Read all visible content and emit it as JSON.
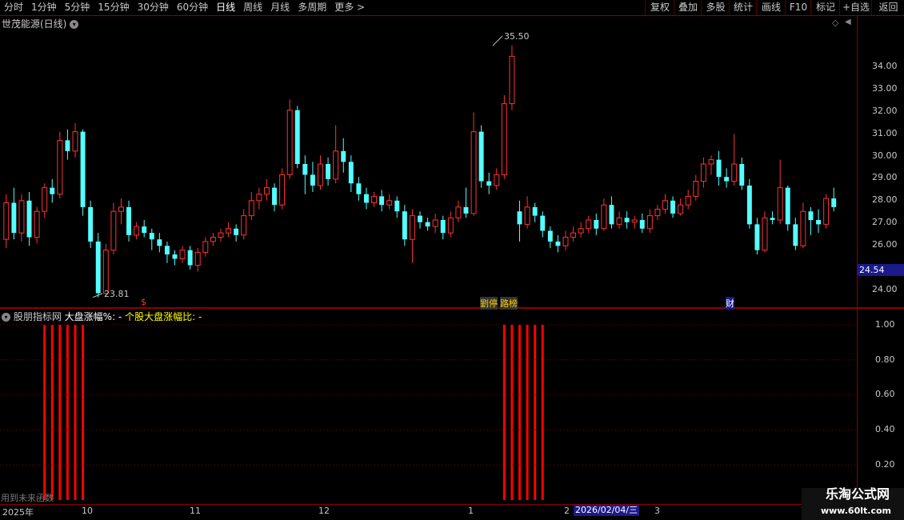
{
  "toolbar": {
    "periods": [
      "分时",
      "1分钟",
      "5分钟",
      "15分钟",
      "30分钟",
      "60分钟",
      "日线",
      "周线",
      "月线",
      "多周期",
      "更多 >"
    ],
    "active_period": "日线",
    "right_buttons": [
      "复权",
      "叠加",
      "多股",
      "统计",
      "画线",
      "F10",
      "标记",
      "+自选",
      "返回"
    ]
  },
  "main_chart": {
    "title": "世茂能源(日线)",
    "high_label": "35.50",
    "low_label": "23.81",
    "price_tag": "24.54",
    "y_ticks": [
      "34.00",
      "33.00",
      "32.00",
      "31.00",
      "30.00",
      "29.00",
      "28.00",
      "27.00",
      "26.00",
      "24.00"
    ],
    "markers": [
      {
        "text": "$",
        "color": "#ff3030"
      },
      {
        "text": "劉停",
        "color": "#ffcc00"
      },
      {
        "text": "路榜",
        "color": "#ffcc00"
      },
      {
        "text": "财",
        "color": "#ffffff"
      }
    ]
  },
  "indicator": {
    "name": "股朋指标网",
    "line1": "大盘涨幅%: -",
    "line2": "个股大盘涨幅比: -",
    "y_ticks": [
      "1.00",
      "0.80",
      "0.60",
      "0.40",
      "0.20"
    ],
    "footer_note": "用到未来函数"
  },
  "time_axis": {
    "labels": [
      "2025年",
      "10",
      "11",
      "12",
      "1",
      "2",
      "3"
    ],
    "date_tag": "2026/02/04/三"
  },
  "watermark": {
    "line1": "乐淘公式网",
    "line2": "www.60lt.com"
  },
  "colors": {
    "up": "#ff3232",
    "down": "#54ffff",
    "background": "#000000",
    "grid": "#8b0000",
    "bar": "#ff0000",
    "indicator_line1": "#ffffff",
    "indicator_line2": "#ffff00"
  },
  "chart_data": [
    {
      "type": "candlestick",
      "ylim": [
        23.5,
        36.5
      ],
      "high": 35.5,
      "low": 23.81,
      "candles": [
        [
          26.5,
          28.2,
          28.6,
          26.1
        ],
        [
          28.2,
          26.8,
          28.9,
          26.5
        ],
        [
          26.8,
          28.3,
          28.6,
          26.4
        ],
        [
          28.3,
          26.6,
          28.7,
          26.2
        ],
        [
          26.6,
          27.8,
          28.0,
          26.3
        ],
        [
          27.8,
          28.9,
          29.1,
          27.5
        ],
        [
          28.9,
          28.6,
          29.3,
          28.2
        ],
        [
          28.6,
          31.1,
          31.5,
          28.4
        ],
        [
          31.1,
          30.6,
          31.6,
          30.2
        ],
        [
          30.6,
          31.5,
          31.9,
          30.3
        ],
        [
          31.5,
          28.0,
          31.6,
          27.6
        ],
        [
          28.0,
          26.4,
          28.3,
          26.1
        ],
        [
          26.4,
          24.0,
          26.8,
          23.81
        ],
        [
          24.0,
          26.0,
          26.3,
          23.9
        ],
        [
          26.0,
          27.8,
          28.2,
          25.8
        ],
        [
          27.8,
          28.0,
          28.4,
          27.2
        ],
        [
          28.0,
          26.7,
          28.3,
          26.4
        ],
        [
          26.7,
          27.1,
          27.3,
          26.5
        ],
        [
          27.1,
          26.8,
          27.4,
          26.6
        ],
        [
          26.8,
          26.5,
          27.0,
          26.0
        ],
        [
          26.5,
          26.2,
          26.8,
          25.9
        ],
        [
          26.2,
          25.8,
          26.4,
          25.4
        ],
        [
          25.8,
          25.6,
          26.0,
          25.3
        ],
        [
          25.6,
          26.0,
          26.2,
          25.4
        ],
        [
          26.0,
          25.3,
          26.2,
          25.1
        ],
        [
          25.3,
          25.9,
          26.1,
          25.0
        ],
        [
          25.9,
          26.4,
          26.6,
          25.7
        ],
        [
          26.4,
          26.6,
          26.8,
          26.2
        ],
        [
          26.6,
          26.8,
          27.0,
          26.4
        ],
        [
          26.8,
          27.0,
          27.3,
          26.6
        ],
        [
          27.0,
          26.7,
          27.2,
          26.4
        ],
        [
          26.7,
          27.6,
          27.9,
          26.5
        ],
        [
          27.6,
          28.3,
          28.7,
          27.4
        ],
        [
          28.3,
          28.6,
          28.9,
          27.9
        ],
        [
          28.6,
          28.9,
          29.3,
          28.3
        ],
        [
          28.9,
          28.1,
          29.1,
          27.8
        ],
        [
          28.1,
          29.5,
          29.8,
          27.9
        ],
        [
          29.5,
          32.5,
          33.0,
          29.3
        ],
        [
          32.5,
          30.0,
          32.7,
          29.8
        ],
        [
          30.0,
          29.5,
          30.4,
          28.6
        ],
        [
          29.5,
          29.0,
          30.1,
          28.7
        ],
        [
          29.0,
          30.0,
          30.4,
          28.8
        ],
        [
          30.0,
          29.3,
          30.3,
          29.0
        ],
        [
          29.3,
          30.6,
          31.8,
          29.1
        ],
        [
          30.6,
          30.1,
          31.2,
          29.6
        ],
        [
          30.1,
          29.1,
          30.4,
          28.7
        ],
        [
          29.1,
          28.6,
          29.4,
          28.3
        ],
        [
          28.6,
          28.2,
          28.9,
          27.9
        ],
        [
          28.2,
          28.5,
          28.7,
          28.0
        ],
        [
          28.5,
          28.1,
          28.8,
          27.8
        ],
        [
          28.1,
          28.3,
          28.6,
          27.9
        ],
        [
          28.3,
          27.8,
          28.5,
          27.5
        ],
        [
          27.8,
          26.5,
          28.1,
          26.2
        ],
        [
          26.5,
          27.6,
          27.9,
          25.4
        ],
        [
          27.6,
          27.3,
          27.8,
          27.0
        ],
        [
          27.3,
          27.1,
          27.5,
          26.9
        ],
        [
          27.1,
          27.4,
          27.7,
          26.8
        ],
        [
          27.4,
          26.8,
          27.6,
          26.5
        ],
        [
          26.8,
          27.5,
          27.8,
          26.6
        ],
        [
          27.5,
          28.0,
          28.3,
          27.3
        ],
        [
          28.0,
          27.7,
          28.9,
          27.5
        ],
        [
          27.7,
          31.5,
          32.4,
          27.6
        ],
        [
          31.5,
          29.2,
          31.8,
          28.9
        ],
        [
          29.2,
          29.0,
          29.6,
          28.6
        ],
        [
          29.0,
          29.5,
          29.8,
          28.8
        ],
        [
          29.5,
          32.8,
          33.2,
          29.3
        ],
        [
          32.8,
          35.0,
          35.5,
          32.5
        ],
        [
          27.8,
          27.2,
          28.3,
          26.4
        ],
        [
          27.2,
          28.0,
          28.5,
          27.0
        ],
        [
          28.0,
          27.6,
          28.2,
          27.3
        ],
        [
          27.6,
          26.9,
          27.8,
          26.6
        ],
        [
          26.9,
          26.4,
          27.1,
          26.1
        ],
        [
          26.4,
          26.2,
          26.7,
          25.9
        ],
        [
          26.2,
          26.6,
          26.9,
          26.0
        ],
        [
          26.6,
          26.8,
          27.1,
          26.4
        ],
        [
          26.8,
          27.0,
          27.3,
          26.6
        ],
        [
          27.0,
          27.4,
          27.6,
          26.8
        ],
        [
          27.4,
          27.0,
          27.7,
          26.7
        ],
        [
          27.0,
          28.1,
          28.4,
          26.9
        ],
        [
          28.1,
          27.2,
          28.5,
          27.0
        ],
        [
          27.2,
          27.5,
          27.8,
          27.0
        ],
        [
          27.5,
          27.3,
          27.8,
          27.0
        ],
        [
          27.3,
          27.4,
          27.6,
          27.0
        ],
        [
          27.4,
          27.0,
          27.7,
          26.8
        ],
        [
          27.0,
          27.6,
          27.9,
          26.8
        ],
        [
          27.6,
          27.9,
          28.1,
          27.4
        ],
        [
          27.9,
          28.3,
          28.6,
          27.7
        ],
        [
          28.3,
          27.7,
          28.5,
          27.5
        ],
        [
          27.7,
          28.1,
          28.4,
          27.6
        ],
        [
          28.1,
          28.5,
          28.8,
          27.9
        ],
        [
          28.5,
          29.2,
          29.5,
          28.3
        ],
        [
          29.2,
          30.0,
          30.3,
          28.9
        ],
        [
          30.0,
          30.2,
          30.4,
          29.5
        ],
        [
          30.2,
          29.4,
          30.6,
          29.0
        ],
        [
          29.4,
          29.2,
          29.8,
          28.9
        ],
        [
          29.2,
          30.0,
          31.4,
          29.0
        ],
        [
          30.0,
          29.0,
          30.3,
          28.8
        ],
        [
          29.0,
          27.2,
          29.3,
          27.0
        ],
        [
          27.2,
          26.0,
          27.5,
          25.8
        ],
        [
          26.0,
          27.5,
          27.8,
          25.9
        ],
        [
          27.5,
          27.4,
          27.8,
          27.2
        ],
        [
          27.4,
          28.9,
          30.2,
          27.2
        ],
        [
          28.9,
          27.2,
          29.0,
          26.9
        ],
        [
          27.2,
          26.2,
          27.5,
          26.0
        ],
        [
          26.2,
          27.8,
          28.2,
          26.1
        ],
        [
          27.8,
          27.4,
          28.0,
          26.7
        ],
        [
          27.4,
          27.2,
          27.9,
          26.8
        ],
        [
          27.2,
          28.4,
          28.6,
          27.0
        ],
        [
          28.4,
          28.0,
          28.9,
          27.8
        ]
      ]
    },
    {
      "type": "bar",
      "title": "大盘涨幅%",
      "ylim": [
        0,
        1.05
      ],
      "bar_indices": [
        5,
        6,
        7,
        8,
        9,
        10,
        65,
        66,
        67,
        68,
        69,
        70
      ],
      "values": [
        1,
        1,
        1,
        1,
        1,
        1,
        1,
        1,
        1,
        1,
        1,
        1
      ]
    }
  ]
}
